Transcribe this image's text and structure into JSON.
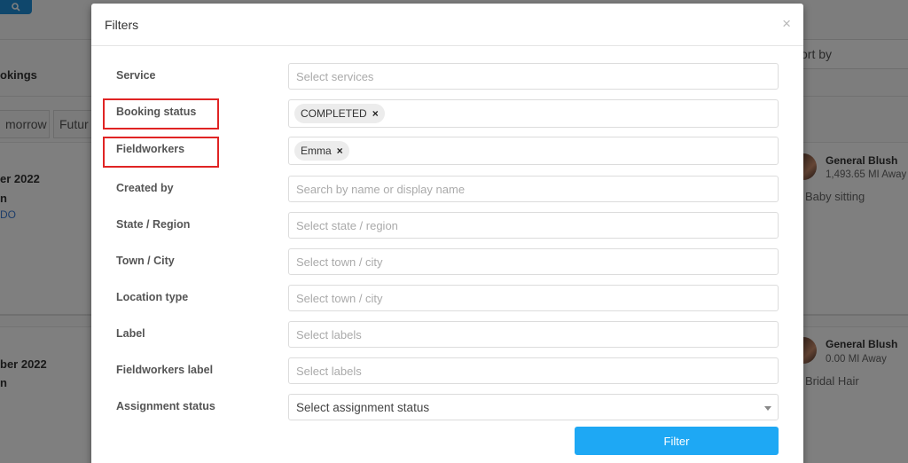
{
  "background": {
    "header_partial": "okings",
    "sort_by": "ort by",
    "tabs": [
      "morrow",
      "Futur"
    ],
    "cards": [
      {
        "date_partial": "er 2022",
        "line2_partial": "n",
        "line3_partial": "DO",
        "fieldworker": "General Blush",
        "distance": "1,493.65 MI Away",
        "service": "Baby sitting"
      },
      {
        "date_partial": "ber 2022",
        "line2_partial": "n",
        "fieldworker": "General Blush",
        "distance": "0.00 MI Away",
        "service": "Bridal Hair"
      }
    ]
  },
  "modal": {
    "title": "Filters",
    "close": "×",
    "fields": {
      "service": {
        "label": "Service",
        "placeholder": "Select services"
      },
      "booking_status": {
        "label": "Booking status",
        "tag": "COMPLETED",
        "tag_remove": "×"
      },
      "fieldworkers": {
        "label": "Fieldworkers",
        "tag": "Emma",
        "tag_remove": "×"
      },
      "created_by": {
        "label": "Created by",
        "placeholder": "Search by name or display name"
      },
      "state_region": {
        "label": "State / Region",
        "placeholder": "Select state / region"
      },
      "town_city": {
        "label": "Town / City",
        "placeholder": "Select town / city"
      },
      "location_type": {
        "label": "Location type",
        "placeholder": "Select town / city"
      },
      "label": {
        "label": "Label",
        "placeholder": "Select labels"
      },
      "fieldworkers_label": {
        "label": "Fieldworkers label",
        "placeholder": "Select labels"
      },
      "assignment_status": {
        "label": "Assignment status",
        "value": "Select assignment status"
      }
    },
    "filter_button": "Filter"
  },
  "colors": {
    "primary_button": "#1ea8f4",
    "highlight_box": "#e02424",
    "search_button": "#1e8fd8"
  }
}
